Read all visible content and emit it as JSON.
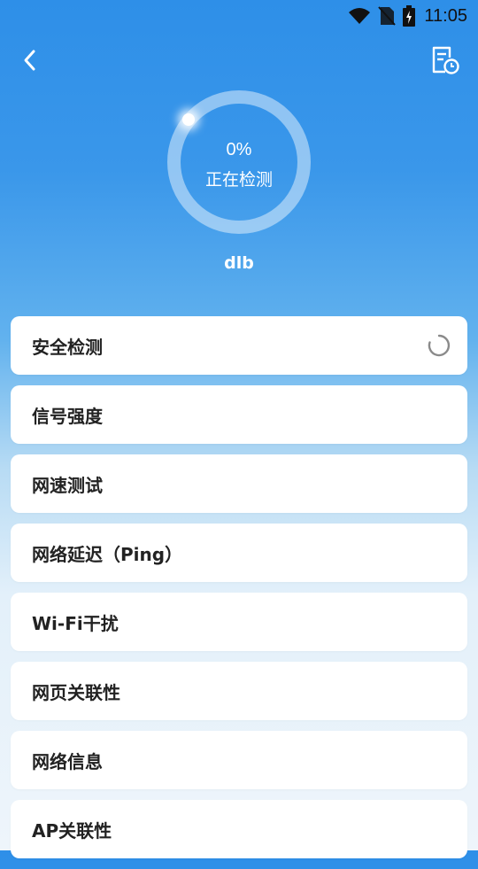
{
  "status_bar": {
    "time": "11:05",
    "icons": [
      "wifi-icon",
      "no-sim-icon",
      "battery-charging-icon"
    ]
  },
  "header": {
    "back_icon": "chevron-left-icon",
    "history_icon": "report-clock-icon"
  },
  "progress": {
    "percent_text": "0%",
    "percent": 0,
    "status_text": "正在检测"
  },
  "network": {
    "ssid": "dlb"
  },
  "checks": [
    {
      "label": "安全检测",
      "state": "loading"
    },
    {
      "label": "信号强度"
    },
    {
      "label": "网速测试"
    },
    {
      "label": "网络延迟（Ping）"
    },
    {
      "label": "Wi-Fi干扰"
    },
    {
      "label": "网页关联性"
    },
    {
      "label": "网络信息"
    },
    {
      "label": "AP关联性"
    }
  ],
  "colors": {
    "gradient_top": "#2e8fe8",
    "gradient_bottom": "#eef5fb",
    "card": "#ffffff",
    "text": "#222222"
  }
}
